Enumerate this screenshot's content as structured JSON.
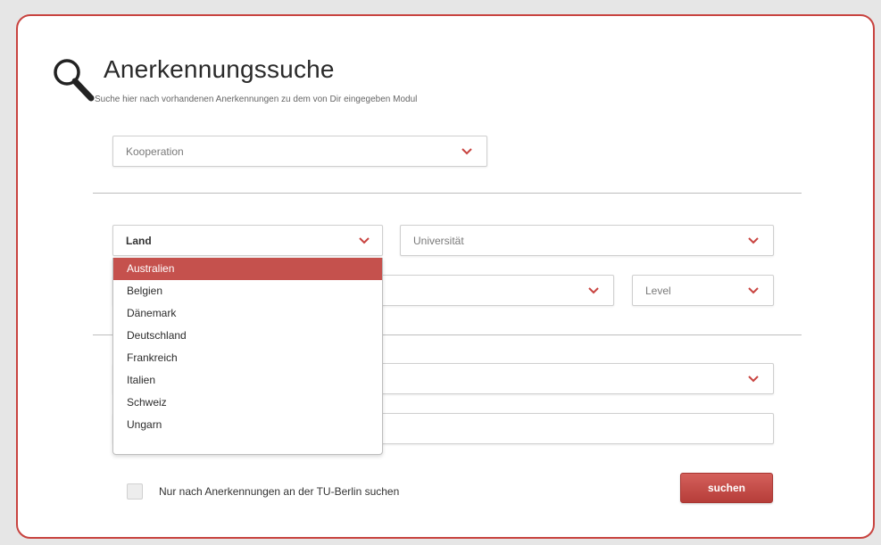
{
  "header": {
    "title": "Anerkennungssuche",
    "subtitle": "Suche hier nach vorhandenen Anerkennungen zu dem von Dir eingegeben Modul"
  },
  "filters": {
    "kooperation": "Kooperation",
    "land": "Land",
    "universitaet": "Universität",
    "level": "Level"
  },
  "land_dropdown": {
    "options": [
      "Australien",
      "Belgien",
      "Dänemark",
      "Deutschland",
      "Frankreich",
      "Italien",
      "Schweiz",
      "Ungarn"
    ],
    "selected_index": 0
  },
  "footer": {
    "checkbox_label": "Nur nach Anerkennungen an der TU-Berlin suchen",
    "checkbox_checked": false,
    "search_button": "suchen"
  },
  "colors": {
    "accent": "#c8433f",
    "selected_option_bg": "#c5514d"
  },
  "icons": {
    "search": "magnifying-glass-icon",
    "dropdown": "chevron-down-icon"
  }
}
